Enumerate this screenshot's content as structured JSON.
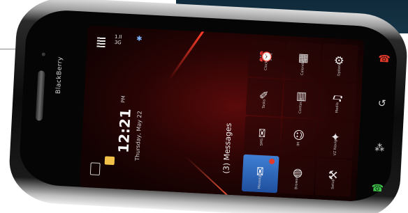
{
  "panel": {
    "color": "#143244"
  },
  "phone": {
    "brand": "BlackBerry",
    "status": {
      "network": "1.ll\n3G",
      "bluetooth_icon": "bluetooth-icon"
    },
    "clock": {
      "time": "12:21",
      "ampm": "PM",
      "date": "Thursday, May 22"
    },
    "messages_banner": "(3) Messages",
    "icons": [
      {
        "name": "clock-icon",
        "glyph": "⏰",
        "label": "Clock"
      },
      {
        "name": "calendar-icon",
        "glyph": "▦",
        "label": "Calendar"
      },
      {
        "name": "options-icon",
        "glyph": "⚙",
        "label": "Options"
      },
      {
        "name": "tasks-icon",
        "glyph": "✎",
        "label": "Tasks"
      },
      {
        "name": "contacts-icon",
        "glyph": "▤",
        "label": "Contacts"
      },
      {
        "name": "media-icon",
        "glyph": "♫",
        "label": "Media"
      },
      {
        "name": "sms-icon",
        "glyph": "✉",
        "label": "SMS"
      },
      {
        "name": "im-icon",
        "glyph": "☺",
        "label": "IM"
      },
      {
        "name": "vz-navigator-icon",
        "glyph": "✦",
        "label": "VZ Navigat"
      },
      {
        "name": "messages-icon",
        "glyph": "✉",
        "label": "Messages",
        "selected": true,
        "badge": true
      },
      {
        "name": "browser-icon",
        "glyph": "◍",
        "label": "Browser"
      },
      {
        "name": "setup-icon",
        "glyph": "⚒",
        "label": "Setup"
      }
    ],
    "keys": {
      "end_color": "#e23a2a",
      "call_color": "#3fc24a"
    }
  }
}
